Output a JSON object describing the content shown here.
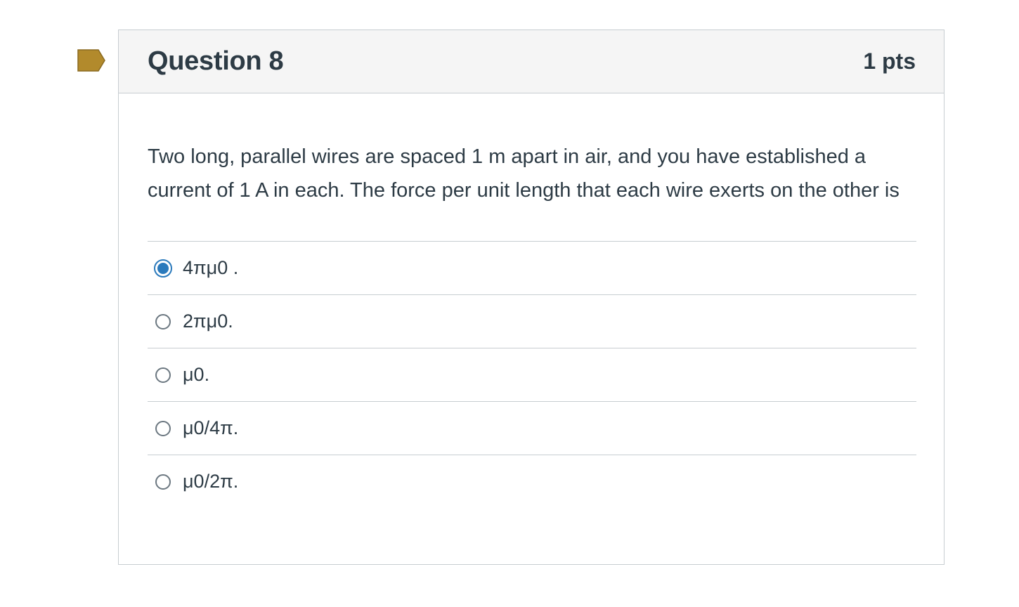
{
  "question": {
    "title": "Question 8",
    "points": "1 pts",
    "text": "Two long, parallel wires are spaced 1 m apart in air, and you have established a current of 1 A in each. The force per unit length that each wire exerts on the other is"
  },
  "answers": [
    {
      "label": "4πμ0 .",
      "selected": true
    },
    {
      "label": "2πμ0.",
      "selected": false
    },
    {
      "label": "μ0.",
      "selected": false
    },
    {
      "label": "μ0/4π.",
      "selected": false
    },
    {
      "label": "μ0/2π.",
      "selected": false
    }
  ],
  "colors": {
    "flag": "#b28a2c",
    "accent": "#2b7abc",
    "text": "#2d3b45",
    "header_bg": "#f5f5f5",
    "border": "#c7cdd1"
  },
  "icons": {
    "flag": "bookmark-flag-icon"
  }
}
